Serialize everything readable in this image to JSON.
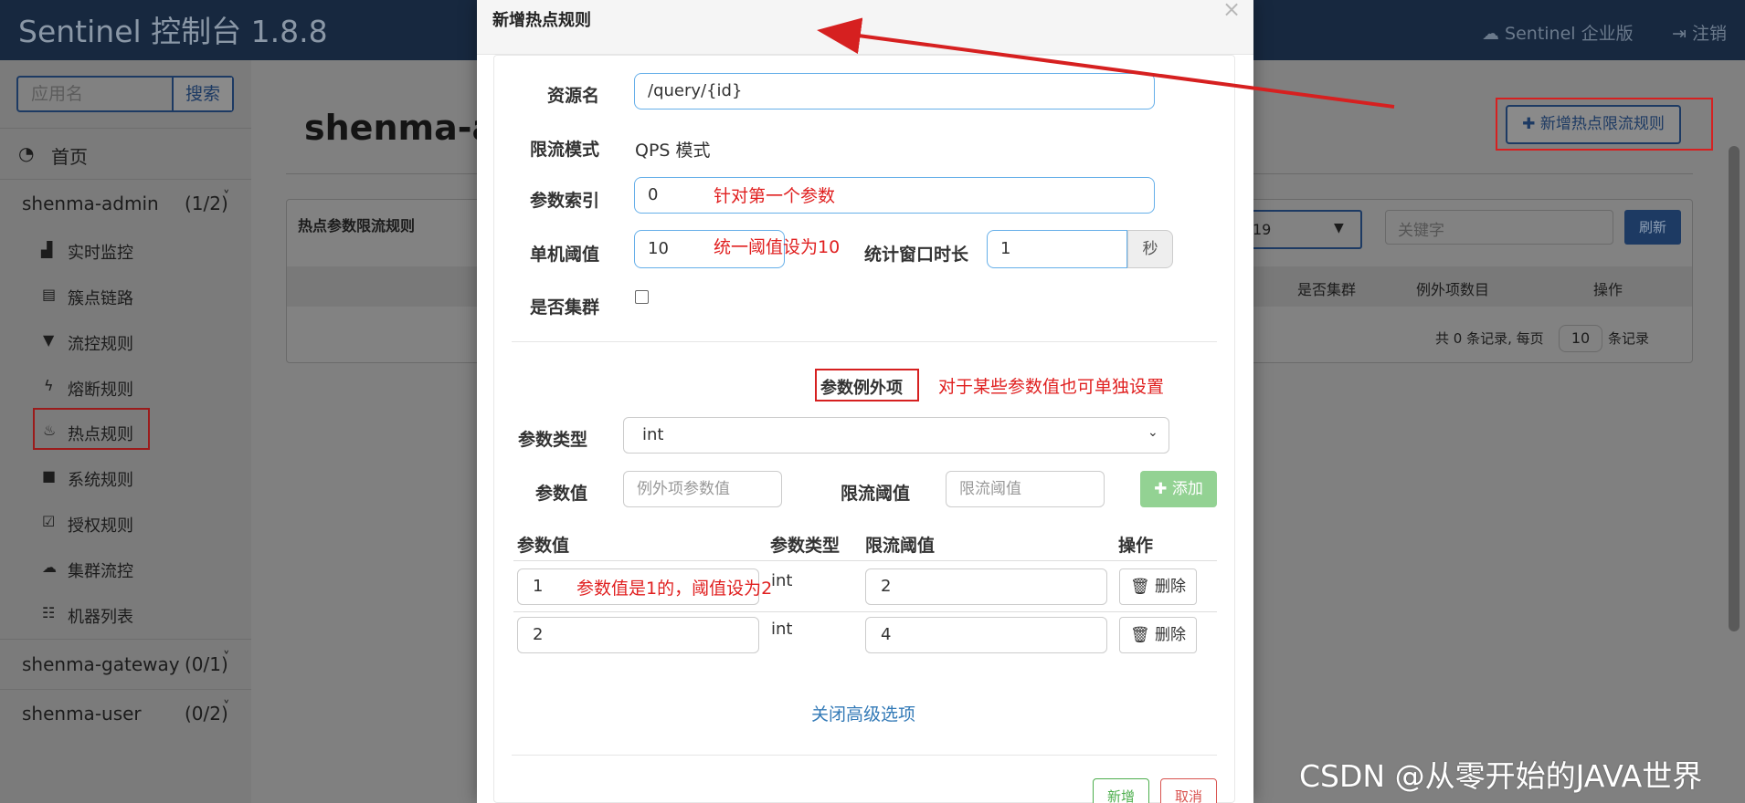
{
  "app": {
    "title": "Sentinel 控制台 1.8.8",
    "enterprise_link": "☁ Sentinel 企业版",
    "logout_link": "⇥ 注销"
  },
  "sidebar": {
    "search_placeholder": "应用名",
    "search_button": "搜索",
    "home": "首页",
    "apps": [
      {
        "name": "shenma-admin",
        "count": "(1/2)"
      },
      {
        "name": "shenma-gateway",
        "count": "(0/1)"
      },
      {
        "name": "shenma-user",
        "count": "(0/2)"
      }
    ],
    "menu": [
      {
        "icon": "chart-icon",
        "label": "实时监控"
      },
      {
        "icon": "list-icon",
        "label": "簇点链路"
      },
      {
        "icon": "filter-icon",
        "label": "流控规则"
      },
      {
        "icon": "bolt-icon",
        "label": "熔断规则"
      },
      {
        "icon": "fire-icon",
        "label": "热点规则"
      },
      {
        "icon": "lock-icon",
        "label": "系统规则"
      },
      {
        "icon": "check-icon",
        "label": "授权规则"
      },
      {
        "icon": "cloud-icon",
        "label": "集群流控"
      },
      {
        "icon": "table-icon",
        "label": "机器列表"
      }
    ]
  },
  "content": {
    "title": "shenma-ad",
    "new_rule_button": "✚ 新增热点限流规则",
    "panel_title": "热点参数限流规则",
    "app_select_value": "19",
    "keyword_placeholder": "关键字",
    "refresh_button": "刷新",
    "columns": [
      "是否集群",
      "例外项数目",
      "操作"
    ],
    "pager_text": "共 0 条记录, 每页",
    "pager_size": "10",
    "pager_suffix": "条记录"
  },
  "modal": {
    "title": "新增热点规则",
    "resource_label": "资源名",
    "resource_value": "/query/{id}",
    "mode_label": "限流模式",
    "mode_value": "QPS 模式",
    "param_index_label": "参数索引",
    "param_index_value": "0",
    "threshold_label": "单机阈值",
    "threshold_value": "10",
    "window_label": "统计窗口时长",
    "window_value": "1",
    "window_unit": "秒",
    "cluster_label": "是否集群",
    "exception_heading": "参数例外项",
    "param_type_label": "参数类型",
    "param_type_value": "int",
    "param_value_label": "参数值",
    "param_value_placeholder": "例外项参数值",
    "limit_threshold_label": "限流阈值",
    "limit_threshold_placeholder": "限流阈值",
    "add_button": "✚ 添加",
    "table_headers": [
      "参数值",
      "参数类型",
      "限流阈值",
      "操作"
    ],
    "rows": [
      {
        "value": "1",
        "type": "int",
        "threshold": "2",
        "delete": "🗑 删除"
      },
      {
        "value": "2",
        "type": "int",
        "threshold": "4",
        "delete": "🗑 删除"
      }
    ],
    "close_advanced": "关闭高级选项",
    "save_button": "新增",
    "cancel_button": "取消"
  },
  "annotations": {
    "param_index_note": "针对第一个参数",
    "threshold_note": "统一阈值设为10",
    "exception_note": "对于某些参数值也可单独设置",
    "row_note": "参数值是1的，阈值设为2"
  },
  "watermark": "CSDN @从零开始的JAVA世界",
  "colors": {
    "topbar": "#17283f",
    "accent_red": "#d62020",
    "link_blue": "#337ab7",
    "add_green": "#93d293"
  }
}
